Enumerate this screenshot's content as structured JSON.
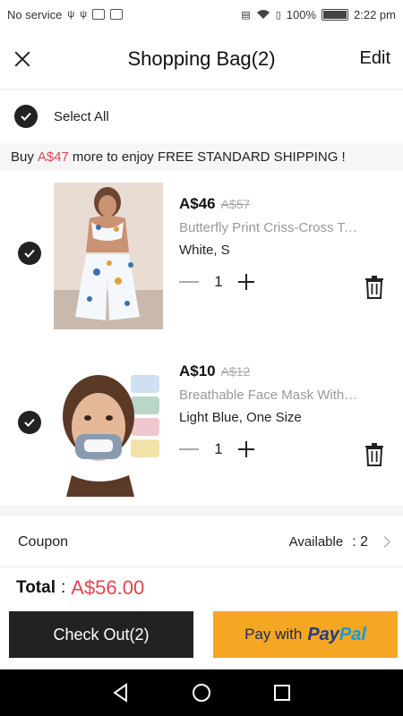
{
  "status_bar": {
    "carrier": "No service",
    "battery": "100%",
    "battery_level": 1.0,
    "time": "2:22 pm"
  },
  "header": {
    "title": "Shopping Bag(2)",
    "edit_label": "Edit"
  },
  "select_all": {
    "label": "Select All",
    "checked": true
  },
  "shipping_banner": {
    "prefix": "Buy",
    "amount": "A$47",
    "suffix": "more to enjoy FREE STANDARD SHIPPING !"
  },
  "items": [
    {
      "price": "A$46",
      "original_price": "A$57",
      "name": "Butterfly Print Criss-Cross Top & Pants Set",
      "variant": "White, S",
      "quantity": "1",
      "checked": true
    },
    {
      "price": "A$10",
      "original_price": "A$12",
      "name": "Breathable Face Mask With Clear Window",
      "variant": "Light Blue, One Size",
      "quantity": "1",
      "checked": true
    }
  ],
  "coupon": {
    "label": "Coupon",
    "status": "Available",
    "count": ": 2"
  },
  "total": {
    "label": "Total",
    "colon": ":",
    "amount": "A$56.00"
  },
  "checkout": {
    "label": "Check Out(2)"
  },
  "paypal": {
    "prefix": "Pay with",
    "logo_pay": "Pay",
    "logo_pal": "Pal"
  },
  "colors": {
    "accent_red": "#e0454f",
    "paypal_orange": "#f5a623",
    "dark": "#222222"
  }
}
